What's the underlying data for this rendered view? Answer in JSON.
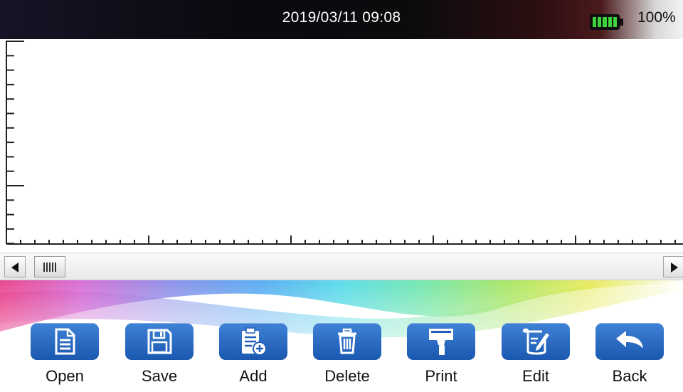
{
  "status_bar": {
    "datetime": "2019/03/11 09:08",
    "battery_level": "100%",
    "battery_fill_fraction": 1.0,
    "battery_color": "#3dd33a"
  },
  "toolbar": {
    "accent": "#2a6bc4",
    "buttons": [
      {
        "label": "Open",
        "icon": "document-icon"
      },
      {
        "label": "Save",
        "icon": "floppy-disk-icon"
      },
      {
        "label": "Add",
        "icon": "clipboard-add-icon"
      },
      {
        "label": "Delete",
        "icon": "trash-icon"
      },
      {
        "label": "Print",
        "icon": "handheld-printer-icon"
      },
      {
        "label": "Edit",
        "icon": "scroll-pencil-icon"
      },
      {
        "label": "Back",
        "icon": "back-arrow-icon"
      }
    ]
  },
  "scrollbar": {
    "position_fraction": 0.0
  }
}
